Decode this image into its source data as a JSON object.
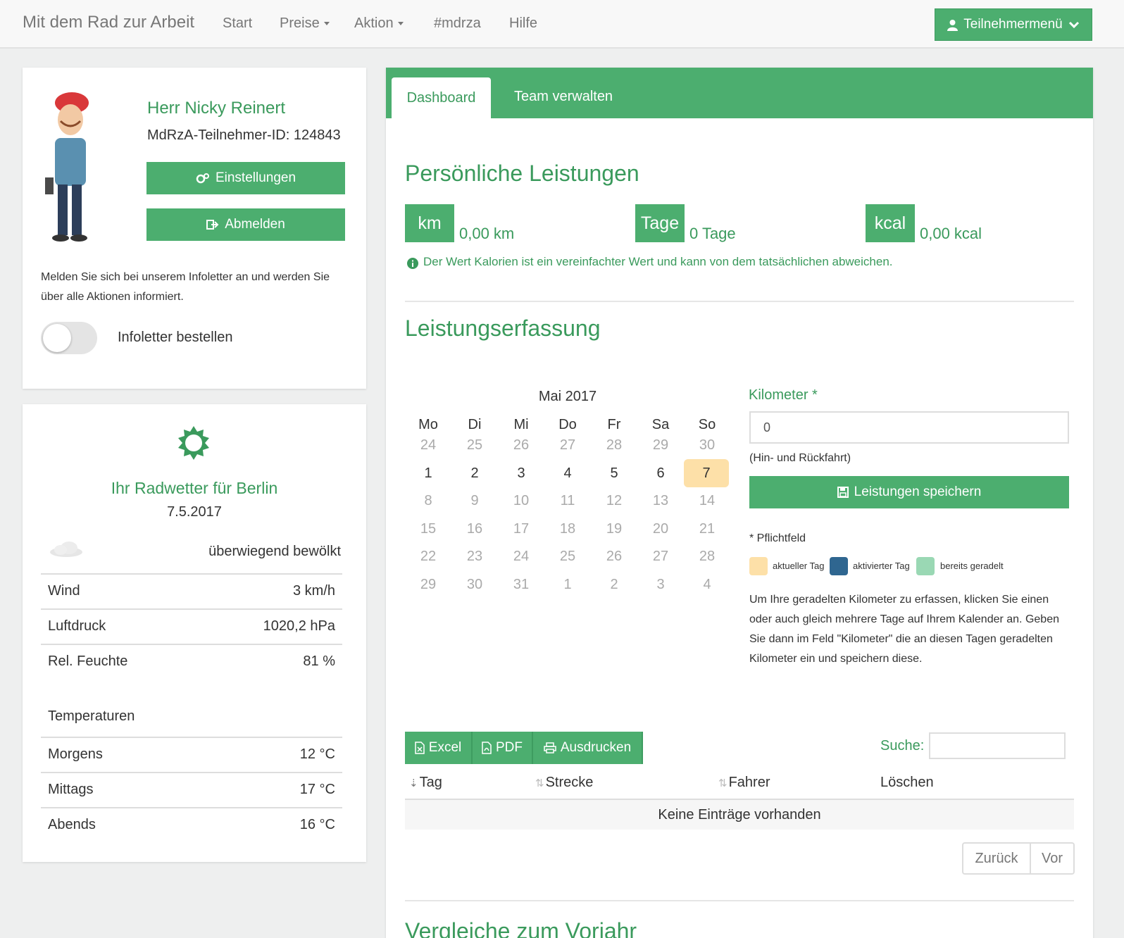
{
  "nav": {
    "brand": "Mit dem Rad zur Arbeit",
    "items": [
      {
        "label": "Start"
      },
      {
        "label": "Preise"
      },
      {
        "label": "Aktion"
      },
      {
        "label": "#mdrza"
      },
      {
        "label": "Hilfe"
      }
    ],
    "menu_button": "Teilnehmermenü",
    "menu_icon": "user-icon"
  },
  "profile": {
    "name": "Herr Nicky Reinert",
    "id_text": "MdRzA-Teilnehmer-ID: 124843",
    "settings_label": "Einstellungen",
    "logout_label": "Abmelden",
    "newsletter_text": "Melden Sie sich bei unserem Infoletter an und werden Sie über alle Aktionen informiert.",
    "newsletter_toggle_label": "Infoletter bestellen"
  },
  "weather": {
    "title": "Ihr Radwetter für Berlin",
    "date": "7.5.2017",
    "condition": "überwiegend bewölkt",
    "rows": [
      {
        "label": "Wind",
        "value": "3 km/h"
      },
      {
        "label": "Luftdruck",
        "value": "1020,2 hPa"
      },
      {
        "label": "Rel. Feuchte",
        "value": "81 %"
      }
    ],
    "temp_heading": "Temperaturen",
    "temps": [
      {
        "label": "Morgens",
        "value": "12 °C"
      },
      {
        "label": "Mittags",
        "value": "17 °C"
      },
      {
        "label": "Abends",
        "value": "16 °C"
      }
    ]
  },
  "tabs": [
    {
      "label": "Dashboard"
    },
    {
      "label": "Team verwalten"
    }
  ],
  "performance": {
    "title": "Persönliche Leistungen",
    "stats": [
      {
        "badge": "km",
        "value": "0,00 km"
      },
      {
        "badge": "Tage",
        "value": "0 Tage"
      },
      {
        "badge": "kcal",
        "value": "0,00 kcal"
      }
    ],
    "info": "Der Wert Kalorien ist ein vereinfachter Wert und kann von dem tatsächlichen abweichen."
  },
  "entry": {
    "title": "Leistungserfassung",
    "calendar": {
      "month": "Mai 2017",
      "weekdays": [
        "Mo",
        "Di",
        "Mi",
        "Do",
        "Fr",
        "Sa",
        "So"
      ],
      "weeks": [
        [
          "24",
          "25",
          "26",
          "27",
          "28",
          "29",
          "30"
        ],
        [
          "1",
          "2",
          "3",
          "4",
          "5",
          "6",
          "7"
        ],
        [
          "8",
          "9",
          "10",
          "11",
          "12",
          "13",
          "14"
        ],
        [
          "15",
          "16",
          "17",
          "18",
          "19",
          "20",
          "21"
        ],
        [
          "22",
          "23",
          "24",
          "25",
          "26",
          "27",
          "28"
        ],
        [
          "29",
          "30",
          "31",
          "1",
          "2",
          "3",
          "4"
        ]
      ]
    },
    "km_label": "Kilometer *",
    "km_value": "0",
    "km_hint": "(Hin- und Rückfahrt)",
    "save_label": "Leistungen speichern",
    "required_note": "* Pflichtfeld",
    "legend": [
      {
        "label": "aktueller Tag",
        "color": "#fde0a8"
      },
      {
        "label": "aktivierter Tag",
        "color": "#2f6690"
      },
      {
        "label": "bereits geradelt",
        "color": "#9ad8b4"
      }
    ],
    "help": "Um Ihre geradelten Kilometer zu erfassen, klicken Sie einen oder auch gleich mehrere Tage auf Ihrem Kalender an. Geben Sie dann im Feld \"Kilometer\" die an diesen Tagen geradelten Kilometer ein und speichern diese."
  },
  "table": {
    "export_buttons": [
      {
        "label": "Excel"
      },
      {
        "label": "PDF"
      },
      {
        "label": "Ausdrucken"
      }
    ],
    "search_label": "Suche:",
    "search_value": "",
    "columns": [
      "Tag",
      "Strecke",
      "Fahrer",
      "Löschen"
    ],
    "empty": "Keine Einträge vorhanden",
    "prev": "Zurück",
    "next": "Vor"
  },
  "compare_title": "Vergleiche zum Vorjahr",
  "colors": {
    "accent": "#4cae6f",
    "accent_text": "#3a9a5c",
    "today": "#fde0a8"
  }
}
